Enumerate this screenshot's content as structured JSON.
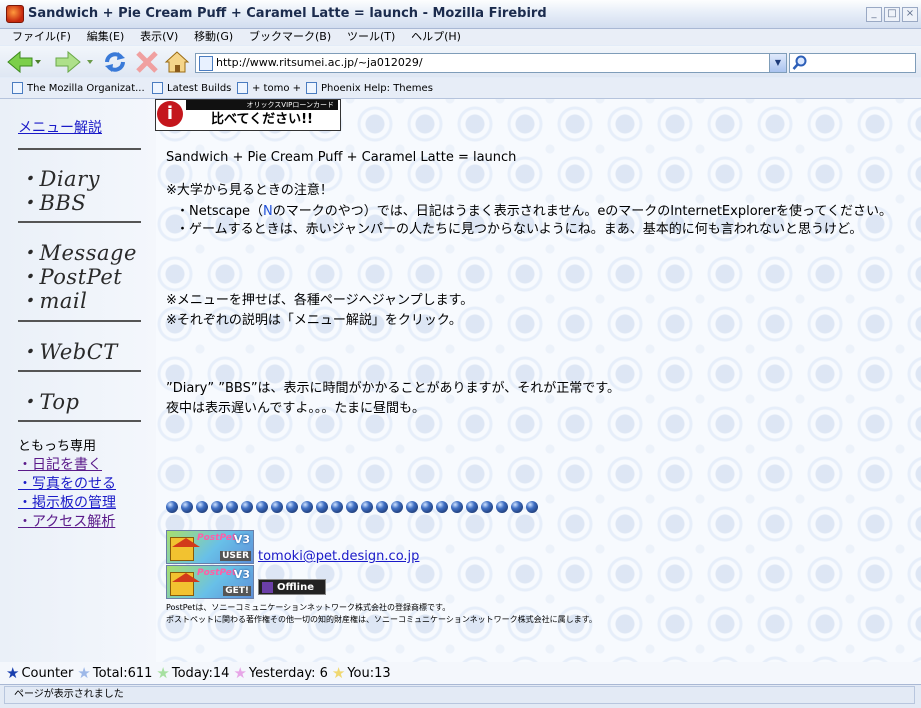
{
  "window": {
    "title": "Sandwich + Pie Cream Puff + Caramel Latte = launch - Mozilla Firebird"
  },
  "menu": [
    "ファイル(F)",
    "編集(E)",
    "表示(V)",
    "移動(G)",
    "ブックマーク(B)",
    "ツール(T)",
    "ヘルプ(H)"
  ],
  "toolbar": {
    "icons": [
      "back-arrow-icon",
      "forward-arrow-icon",
      "reload-icon",
      "stop-icon",
      "home-icon"
    ],
    "url": "http://www.ritsumei.ac.jp/~ja012029/",
    "search_value": ""
  },
  "bookmarks": [
    "The Mozilla Organizat...",
    "Latest Builds",
    "+ tomo +",
    "Phoenix Help: Themes"
  ],
  "sidebar": {
    "help_link": "メニュー解説",
    "groups": [
      [
        "・Diary",
        "・BBS"
      ],
      [
        "・Message",
        "・PostPet",
        "・mail"
      ],
      [
        "・WebCT"
      ],
      [
        "・Top"
      ]
    ],
    "private_label": "ともっち専用",
    "private_links": [
      "・日記を書く",
      "・写真をのせる",
      "・掲示板の管理",
      "・アクセス解析"
    ]
  },
  "banner": {
    "top_text": "オリックスVIPローンカード",
    "main_text": "比べてください!!",
    "logo_letter": "i"
  },
  "main": {
    "heading": "Sandwich + Pie Cream Puff + Caramel Latte = launch",
    "notice_title": "※大学から見るときの注意！",
    "notice_line1_a": "・Netscape（",
    "notice_line1_n": "N",
    "notice_line1_b": "のマークのやつ）では、日記はうまく表示されません。eのマークのInternetExplorerを使ってください。",
    "notice_line2": "・ゲームするときは、赤いジャンパーの人たちに見つからないようにね。まあ、基本的に何も言われないと思うけど。",
    "menu_note1": "※メニューを押せば、各種ページへジャンプします。",
    "menu_note2": "※それぞれの説明は「メニュー解説」をクリック。",
    "slow_note1": "”Diary” ”BBS”は、表示に時間がかかることがありますが、それが正常です。",
    "slow_note2": "夜中は表示遅いんですよ。。。たまに昼間も。",
    "email": "tomoki@pet.design.co.jp",
    "badge1_logo": "PostPet",
    "badge1_version": "V3",
    "badge1_tag": "USER",
    "badge2_logo": "PostPet",
    "badge2_version": "V3",
    "badge2_tag": "GET!",
    "offline_label": "Offline",
    "trademark1": "PostPetは、ソニーコミュニケーションネットワーク株式会社の登録商標です。",
    "trademark2": "ポストペットに関わる著作権その他一切の知的財産権は、ソニーコミュニケーションネットワーク株式会社に属します。"
  },
  "counter": {
    "label": "Counter",
    "total": "Total:611",
    "today": "Today:14",
    "yesterday": "Yesterday: 6",
    "you": "You:13"
  },
  "status": {
    "text": "ページが表示されました"
  },
  "colors": {
    "link": "#1a1ac8",
    "visited_link": "#5a1a8a",
    "accent_blue": "#2050d8",
    "title_text": "#1b2b4d"
  }
}
